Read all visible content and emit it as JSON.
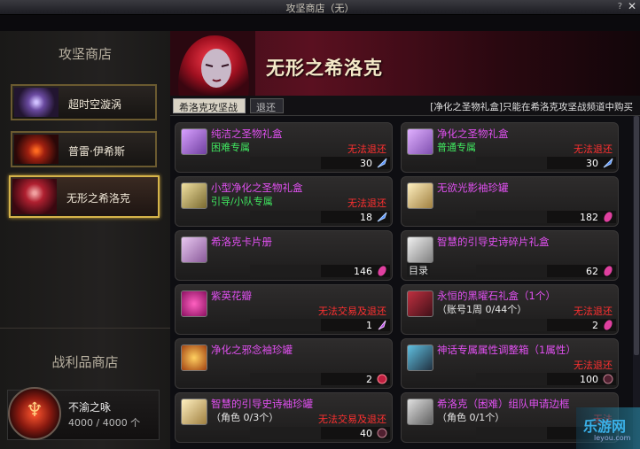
{
  "window": {
    "title": "攻坚商店（无）",
    "help_label": "?",
    "close_label": "✕"
  },
  "left": {
    "section1_title": "攻坚商店",
    "shops": [
      {
        "label": "超时空漩涡"
      },
      {
        "label": "普雷·伊希斯"
      },
      {
        "label": "无形之希洛克"
      }
    ],
    "section2_title": "战利品商店",
    "token": {
      "name": "不渝之咏",
      "count": "4000 / 4000 个"
    }
  },
  "banner": {
    "title": "无形之希洛克"
  },
  "tabs": {
    "active": "希洛克攻坚战",
    "inactive": "退还"
  },
  "notice": "[净化之圣物礼盒]只能在希洛克攻坚战频道中购买",
  "items": [
    {
      "name": "纯洁之圣物礼盒",
      "sub": "困难专属",
      "warn": "无法退还",
      "price": "30",
      "currency_icon": "blue-feather-icon",
      "extra": ""
    },
    {
      "name": "净化之圣物礼盒",
      "sub": "普通专属",
      "warn": "无法退还",
      "price": "30",
      "currency_icon": "blue-feather-icon",
      "extra": ""
    },
    {
      "name": "小型净化之圣物礼盒",
      "sub": "引导/小队专属",
      "warn": "无法退还",
      "price": "18",
      "currency_icon": "blue-feather-icon",
      "extra": ""
    },
    {
      "name": "无欲光影袖珍罐",
      "sub": "",
      "warn": "",
      "price": "182",
      "currency_icon": "pink-petal-icon",
      "extra": ""
    },
    {
      "name": "希洛克卡片册",
      "sub": "",
      "warn": "",
      "price": "146",
      "currency_icon": "pink-petal-icon",
      "extra": ""
    },
    {
      "name": "智慧的引导史诗碎片礼盒",
      "sub": "",
      "warn": "",
      "price": "62",
      "currency_icon": "pink-petal-icon",
      "extra": "目录"
    },
    {
      "name": "紫英花瓣",
      "sub": "",
      "warn": "无法交易及退还",
      "price": "1",
      "currency_icon": "purple-feather-icon",
      "extra": ""
    },
    {
      "name": "永恒的黑曜石礼盒（1个）",
      "sub": "（账号1周 0/44个）",
      "warn": "无法退还",
      "price": "2",
      "currency_icon": "pink-petal-icon",
      "extra": ""
    },
    {
      "name": "净化之邪念袖珍罐",
      "sub": "",
      "warn": "",
      "price": "2",
      "currency_icon": "red-swirl-icon",
      "extra": ""
    },
    {
      "name": "神话专属属性调整箱（1属性）",
      "sub": "",
      "warn": "无法退还",
      "price": "100",
      "currency_icon": "dark-orb-icon",
      "extra": ""
    },
    {
      "name": "智慧的引导史诗袖珍罐",
      "sub": "（角色 0/3个）",
      "warn": "无法交易及退还",
      "price": "40",
      "currency_icon": "dark-orb-icon",
      "extra": ""
    },
    {
      "name": "希洛克（困难）组队申请边框",
      "sub": "（角色 0/1个）",
      "warn": "无法",
      "price": "",
      "currency_icon": "",
      "extra": ""
    }
  ],
  "watermark": {
    "text": "乐游网",
    "sub": "leyou.com"
  },
  "colors": {
    "item_name": "#e050f0",
    "warning": "#ff3030",
    "green_sub": "#40e860",
    "selected_border": "#d6b44a"
  }
}
